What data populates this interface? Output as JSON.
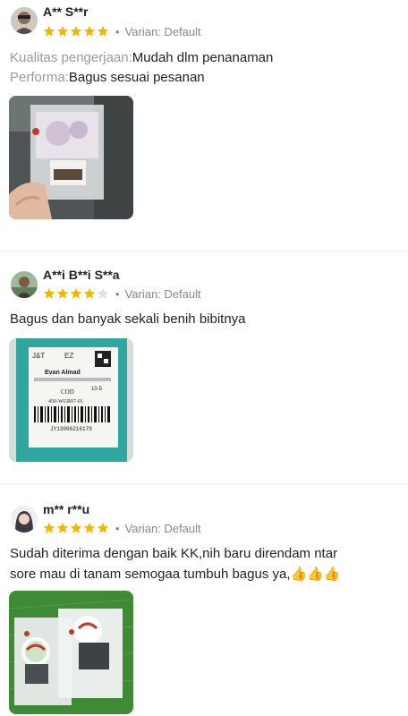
{
  "reviews": [
    {
      "name": "A** S**r",
      "rating": 5,
      "variant": "Varian: Default",
      "lines": [
        {
          "label": "Kualitas pengerjaan:",
          "value": "Mudah dlm penanaman"
        },
        {
          "label": "Performa:",
          "value": "Bagus sesuai pesanan"
        }
      ],
      "photo": "seed-packet-in-hand-photo"
    },
    {
      "name": "A**i B**i S**a",
      "rating": 4,
      "variant": "Varian: Default",
      "text": "Bagus dan banyak sekali benih bibitnya",
      "photo": "shipping-label-package-photo",
      "label_text": {
        "brand": "J&T",
        "code": "EZ",
        "recipient": "Evan Almad",
        "cod": "COD",
        "route": "450-WGR07-01",
        "barcode_num": "JY13006216179",
        "weight": "10-5"
      }
    },
    {
      "name": "m** r**u",
      "rating": 5,
      "variant": "Varian: Default",
      "text_line1": "Sudah diterima dengan baik KK,nih baru direndam ntar",
      "text_line2": "sore mau di tanam semogaa tumbuh bagus ya,",
      "emoji": "👍👍👍",
      "photo": "seed-packets-on-grass-photo"
    }
  ],
  "colors": {
    "star": "#f5b400",
    "star_empty": "#e0e0e0",
    "muted": "#888888",
    "label": "#9a9a9a"
  }
}
